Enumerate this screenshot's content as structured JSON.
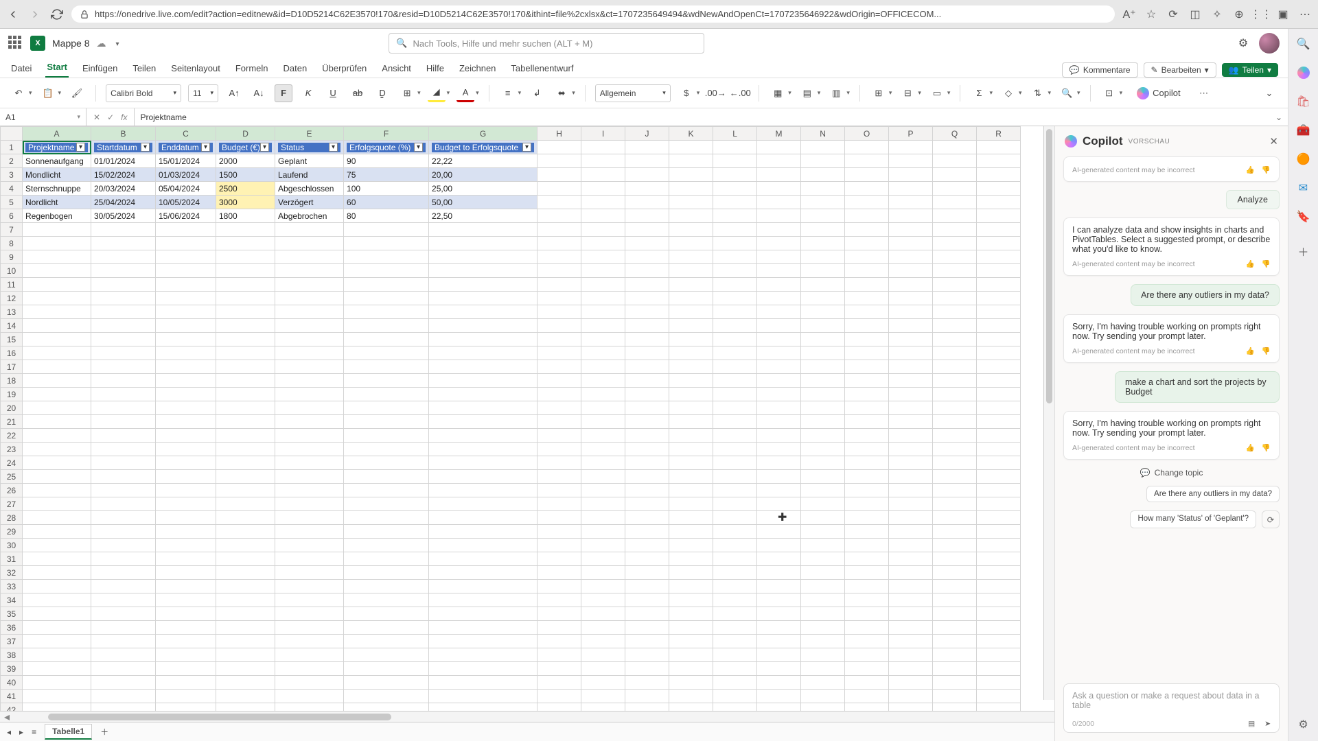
{
  "browser": {
    "url": "https://onedrive.live.com/edit?action=editnew&id=D10D5214C62E3570!170&resid=D10D5214C62E3570!170&ithint=file%2cxlsx&ct=1707235649494&wdNewAndOpenCt=1707235646922&wdOrigin=OFFICECOM..."
  },
  "titlebar": {
    "doc_name": "Mappe 8",
    "search_placeholder": "Nach Tools, Hilfe und mehr suchen (ALT + M)"
  },
  "ribbon": {
    "tabs": [
      "Datei",
      "Start",
      "Einfügen",
      "Teilen",
      "Seitenlayout",
      "Formeln",
      "Daten",
      "Überprüfen",
      "Ansicht",
      "Hilfe",
      "Zeichnen",
      "Tabellenentwurf"
    ],
    "active_tab": "Start",
    "comments": "Kommentare",
    "edit": "Bearbeiten",
    "share": "Teilen"
  },
  "toolbar": {
    "font": "Calibri Bold",
    "size": "11",
    "number_format": "Allgemein",
    "copilot": "Copilot"
  },
  "formula_bar": {
    "name_box": "A1",
    "formula": "Projektname"
  },
  "columns": [
    "A",
    "B",
    "C",
    "D",
    "E",
    "F",
    "G",
    "H",
    "I",
    "J",
    "K",
    "L",
    "M",
    "N",
    "O",
    "P",
    "Q",
    "R"
  ],
  "table": {
    "headers": [
      "Projektname",
      "Startdatum",
      "Enddatum",
      "Budget (€)",
      "Status",
      "Erfolgsquote (%)",
      "Budget to Erfolgsquote"
    ],
    "rows": [
      {
        "name": "Sonnenaufgang",
        "start": "01/01/2024",
        "end": "15/01/2024",
        "budget": "2000",
        "status": "Geplant",
        "quote": "90",
        "ratio": "22,22"
      },
      {
        "name": "Mondlicht",
        "start": "15/02/2024",
        "end": "01/03/2024",
        "budget": "1500",
        "status": "Laufend",
        "quote": "75",
        "ratio": "20,00"
      },
      {
        "name": "Sternschnuppe",
        "start": "20/03/2024",
        "end": "05/04/2024",
        "budget": "2500",
        "status": "Abgeschlossen",
        "quote": "100",
        "ratio": "25,00"
      },
      {
        "name": "Nordlicht",
        "start": "25/04/2024",
        "end": "10/05/2024",
        "budget": "3000",
        "status": "Verzögert",
        "quote": "60",
        "ratio": "50,00"
      },
      {
        "name": "Regenbogen",
        "start": "30/05/2024",
        "end": "15/06/2024",
        "budget": "1800",
        "status": "Abgebrochen",
        "quote": "80",
        "ratio": "22,50"
      }
    ]
  },
  "sheet_tabs": {
    "active": "Tabelle1"
  },
  "copilot": {
    "title": "Copilot",
    "badge": "VORSCHAU",
    "disclaimer": "AI-generated content may be incorrect",
    "analyze": "Analyze",
    "msg_analyze_desc": "I can analyze data and show insights in charts and PivotTables. Select a suggested prompt, or describe what you'd like to know.",
    "user1": "Are there any outliers in my data?",
    "err": "Sorry, I'm having trouble working on prompts right now. Try sending your prompt later.",
    "user2": "make a chart and sort the projects by Budget",
    "change_topic": "Change topic",
    "sugg1": "Are there any outliers in my data?",
    "sugg2": "How many 'Status' of 'Geplant'?",
    "input_placeholder": "Ask a question or make a request about data in a table",
    "counter": "0/2000"
  }
}
